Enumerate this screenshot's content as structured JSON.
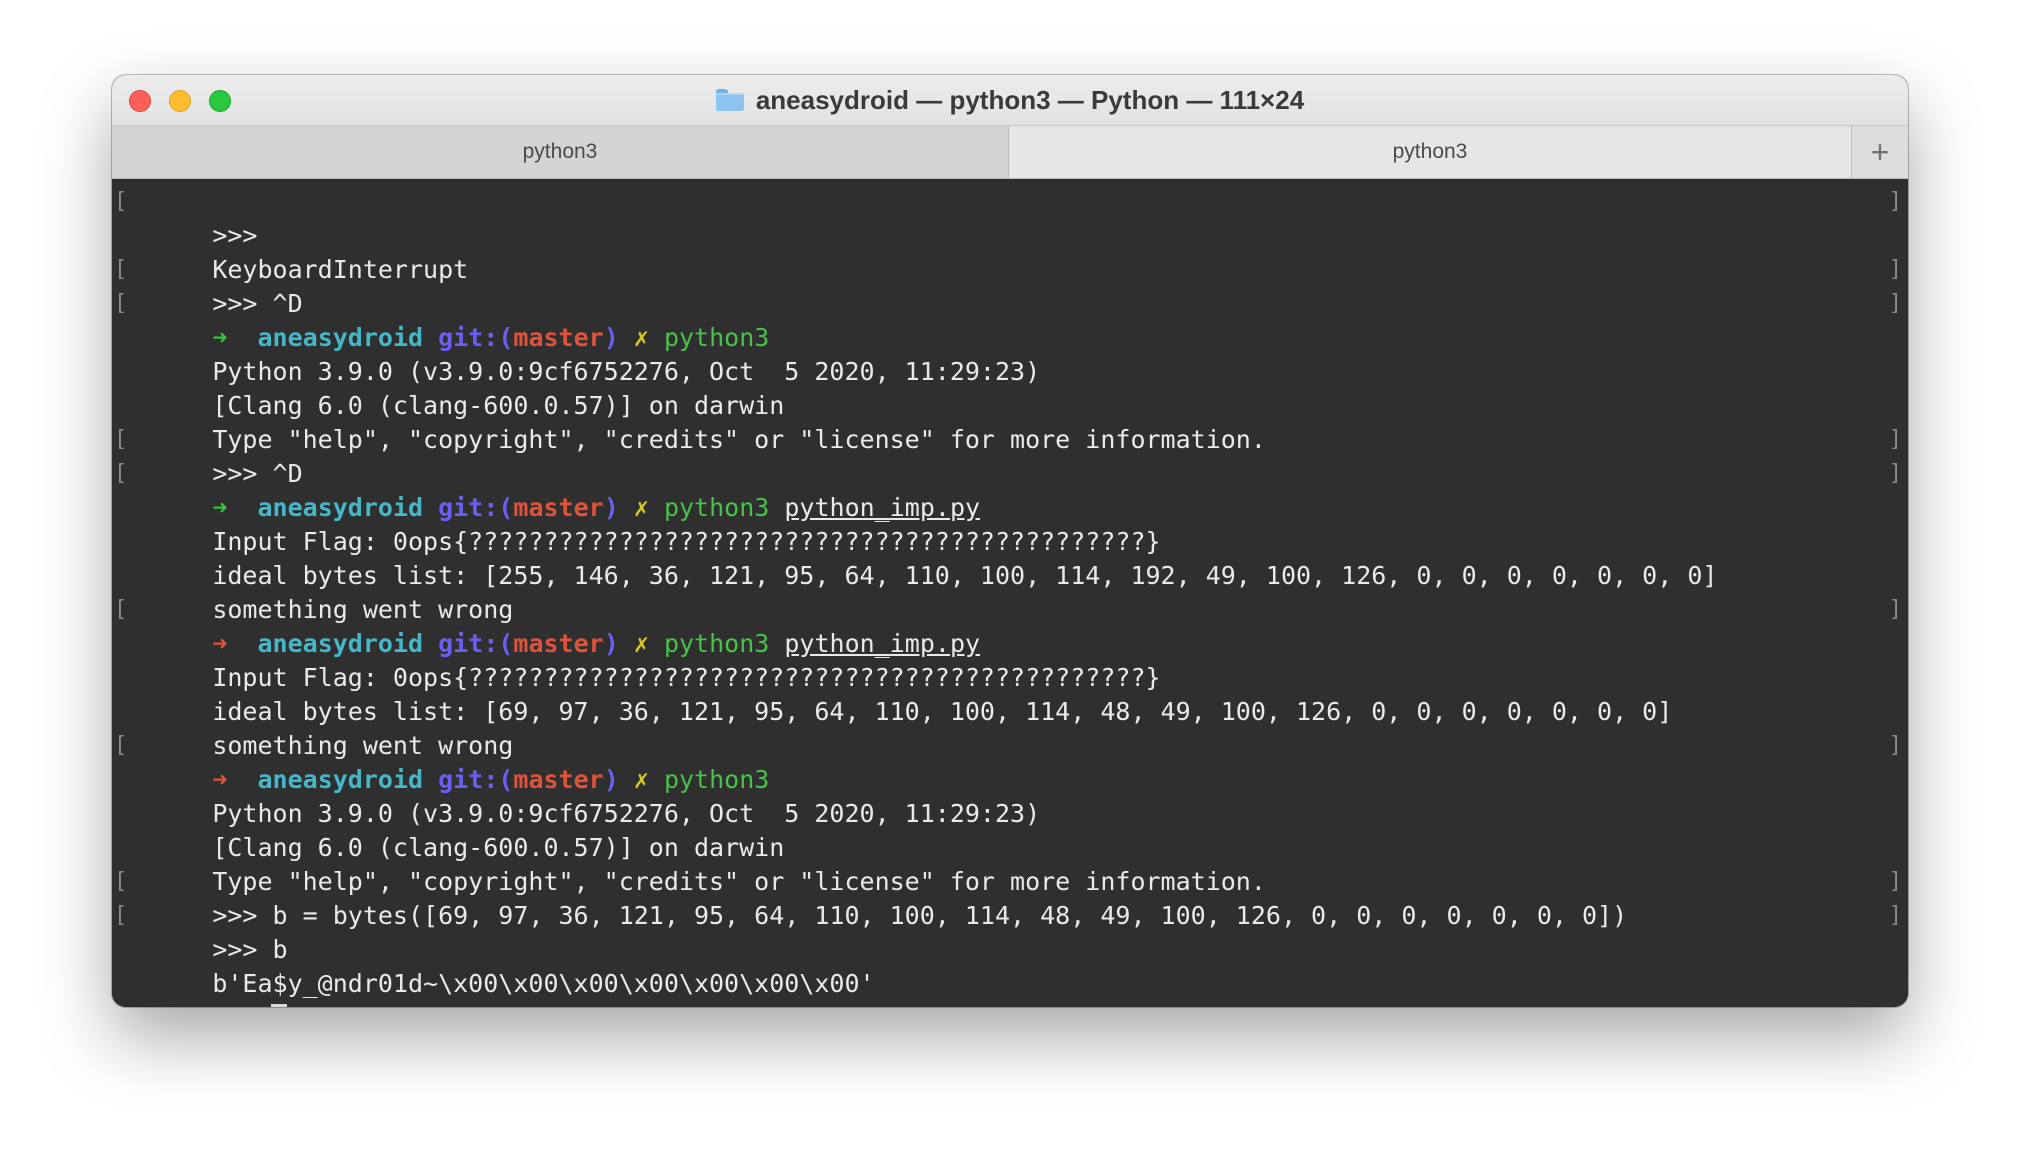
{
  "window": {
    "title": "aneasydroid — python3 — Python — 111×24"
  },
  "tabs": [
    {
      "label": "python3"
    },
    {
      "label": "python3"
    }
  ],
  "new_tab_label": "+",
  "prompt": {
    "dir": "aneasydroid",
    "git_prefix": "git:(",
    "branch": "master",
    "git_suffix": ")",
    "dirty_mark": "✗",
    "arrow": "➜"
  },
  "lines": {
    "l1": ">>>",
    "l2": "KeyboardInterrupt",
    "l3": ">>> ^D",
    "l4_cmd": "python3",
    "l5": "Python 3.9.0 (v3.9.0:9cf6752276, Oct  5 2020, 11:29:23)",
    "l6": "[Clang 6.0 (clang-600.0.57)] on darwin",
    "l7": "Type \"help\", \"copyright\", \"credits\" or \"license\" for more information.",
    "l8": ">>> ^D",
    "l9_cmd": "python3",
    "l9_arg": "python_imp.py",
    "l10": "Input Flag: 0ops{?????????????????????????????????????????????}",
    "l11": "ideal bytes list: [255, 146, 36, 121, 95, 64, 110, 100, 114, 192, 49, 100, 126, 0, 0, 0, 0, 0, 0, 0]",
    "l12": "something went wrong",
    "l13_cmd": "python3",
    "l13_arg": "python_imp.py",
    "l14": "Input Flag: 0ops{?????????????????????????????????????????????}",
    "l15": "ideal bytes list: [69, 97, 36, 121, 95, 64, 110, 100, 114, 48, 49, 100, 126, 0, 0, 0, 0, 0, 0, 0]",
    "l16": "something went wrong",
    "l17_cmd": "python3",
    "l18": "Python 3.9.0 (v3.9.0:9cf6752276, Oct  5 2020, 11:29:23)",
    "l19": "[Clang 6.0 (clang-600.0.57)] on darwin",
    "l20": "Type \"help\", \"copyright\", \"credits\" or \"license\" for more information.",
    "l21": ">>> b = bytes([69, 97, 36, 121, 95, 64, 110, 100, 114, 48, 49, 100, 126, 0, 0, 0, 0, 0, 0, 0])",
    "l22": ">>> b",
    "l23": "b'Ea$y_@ndr01d~\\x00\\x00\\x00\\x00\\x00\\x00\\x00'",
    "l24": ">>>"
  },
  "colors": {
    "terminal_bg": "#2f2f2f",
    "text": "#eaeaea",
    "arrow_success": "#35c53f",
    "arrow_error": "#e0533b",
    "dir": "#44b8c8",
    "git": "#6a5ff0",
    "branch": "#e0533b",
    "dirty_mark": "#d6c92c",
    "command": "#49c249"
  }
}
